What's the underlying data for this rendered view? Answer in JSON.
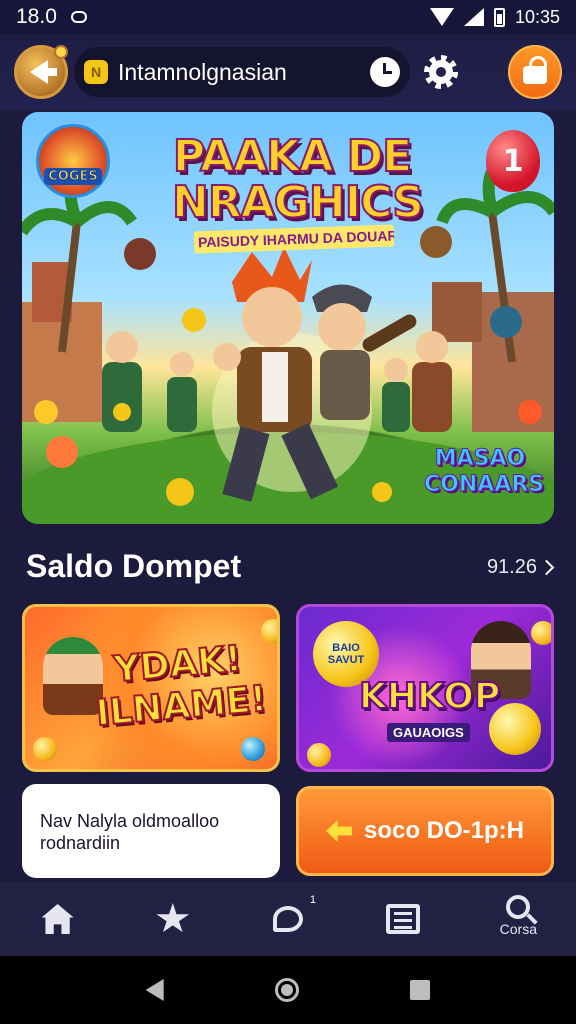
{
  "status_bar": {
    "left_text": "18.0",
    "time": "10:35"
  },
  "header": {
    "search_text": "Intamnolgnasian"
  },
  "hero": {
    "logo_text": "COGES",
    "title_line1": "PAAKA DE",
    "title_line2": "NRAGHICS",
    "subtitle": "PAISUDY IHARMU DA DOUAR!",
    "balloon_number": "1",
    "badge_line1": "MASAO",
    "badge_line2": "CONAARS"
  },
  "section": {
    "title": "Saldo Dompet",
    "link_text": "91.26"
  },
  "cards": [
    {
      "line1": "YDAK!",
      "line2": "ILNAME!"
    },
    {
      "bubble_text": "BAIO SAVUT",
      "title": "KHKOP",
      "subtitle": "GAUAOIGS"
    }
  ],
  "promo": {
    "text": "Nav Nalyla oldmoalloo rodnardiin",
    "button_label": "soco DO-1p:H"
  },
  "bottom_nav": {
    "badge": "1",
    "last_label": "Corsa"
  },
  "icons": [
    "signal-icon",
    "wifi-icon",
    "battery-icon",
    "back-icon",
    "clock-icon",
    "gear-icon",
    "profile-icon",
    "chevron-right-icon",
    "arrow-left-icon",
    "home-icon",
    "star-icon",
    "chat-icon",
    "list-icon",
    "search-icon"
  ],
  "colors": {
    "background": "#1c1b3d",
    "accent_orange": "#f06a10",
    "gold": "#f3c24a",
    "purple": "#9d2ad9"
  }
}
